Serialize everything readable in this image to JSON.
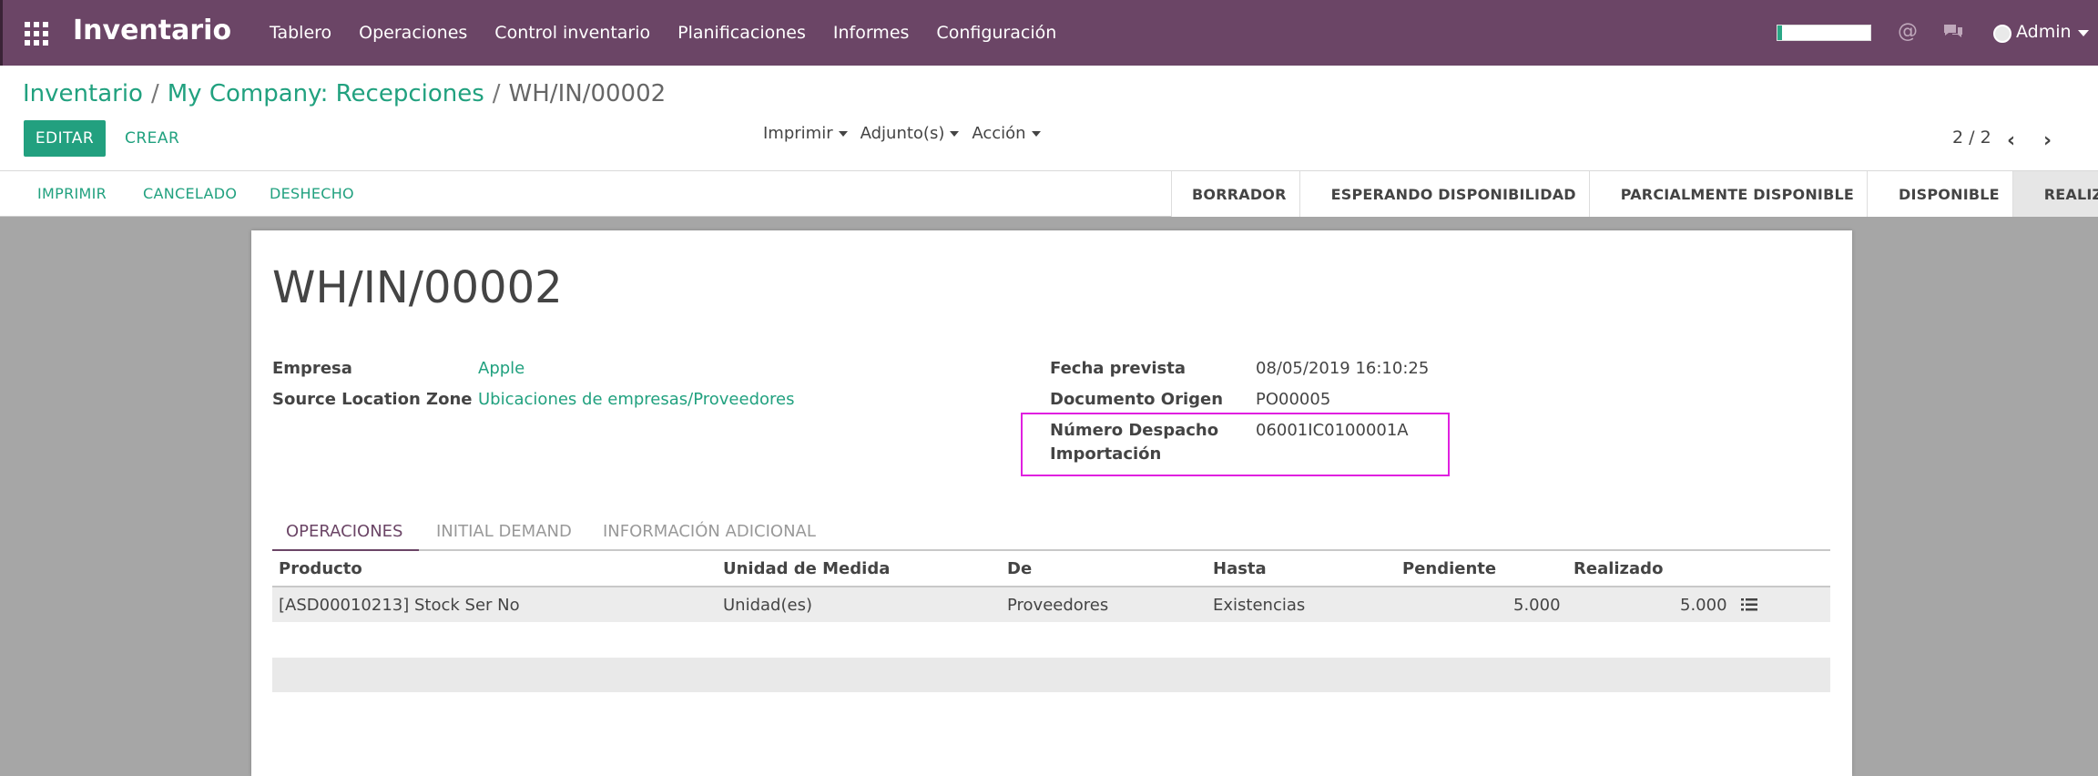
{
  "app": {
    "brand": "Inventario"
  },
  "navbar": {
    "menu": [
      "Tablero",
      "Operaciones",
      "Control inventario",
      "Planificaciones",
      "Informes",
      "Configuración"
    ],
    "user": "Admin",
    "progress_fraction": 0.05
  },
  "breadcrumb": {
    "root": "Inventario",
    "parent": "My Company: Recepciones",
    "current": "WH/IN/00002"
  },
  "buttons": {
    "edit": "EDITAR",
    "create": "CREAR"
  },
  "dropdowns": {
    "print": "Imprimir",
    "attachments": "Adjunto(s)",
    "action": "Acción"
  },
  "pager": {
    "text": "2 / 2"
  },
  "statusbar": {
    "actions": [
      "IMPRIMIR",
      "CANCELADO",
      "DESHECHO"
    ],
    "stages": [
      "BORRADOR",
      "ESPERANDO DISPONIBILIDAD",
      "PARCIALMENTE DISPONIBLE",
      "DISPONIBLE",
      "REALIZADO"
    ],
    "active_stage": "REALIZADO"
  },
  "form": {
    "title": "WH/IN/00002",
    "left": {
      "partner_label": "Empresa",
      "partner_value": "Apple",
      "location_label": "Source Location Zone",
      "location_value": "Ubicaciones de empresas/Proveedores"
    },
    "right": {
      "date_label": "Fecha prevista",
      "date_value": "08/05/2019 16:10:25",
      "origin_label": "Documento Origen",
      "origin_value": "PO00005",
      "import_label_line1": "Número Despacho",
      "import_label_line2": "Importación",
      "import_value": "06001IC0100001A"
    }
  },
  "tabs": [
    "OPERACIONES",
    "INITIAL DEMAND",
    "INFORMACIÓN ADICIONAL"
  ],
  "table": {
    "headers": [
      "Producto",
      "Unidad de Medida",
      "De",
      "Hasta",
      "Pendiente",
      "Realizado"
    ],
    "rows": [
      {
        "product": "[ASD00010213] Stock Ser No",
        "uom": "Unidad(es)",
        "from": "Proveedores",
        "to": "Existencias",
        "pending": "5.000",
        "done": "5.000"
      }
    ]
  },
  "colors": {
    "navbar": "#6b4566",
    "accent": "#21a17f",
    "highlight": "#e020e0"
  }
}
